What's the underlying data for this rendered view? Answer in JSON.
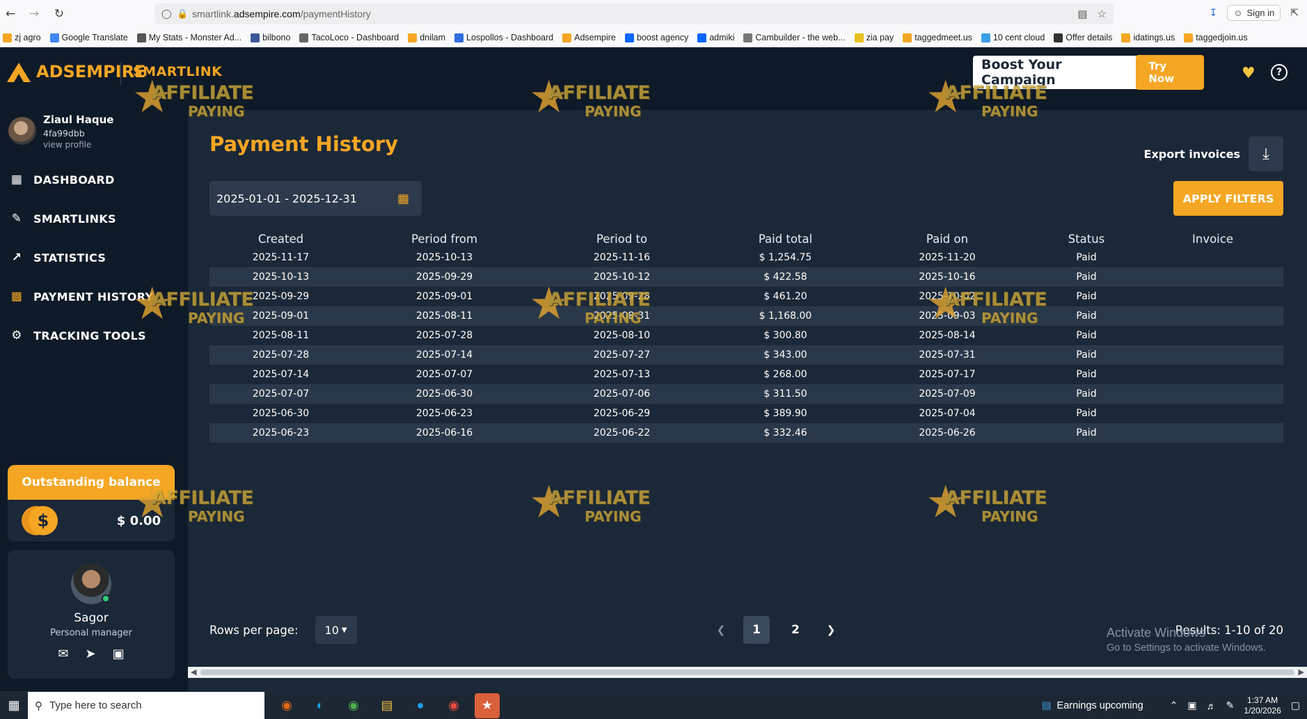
{
  "browser": {
    "url_host": "smartlink.adsempire.com",
    "url_path": "/paymentHistory",
    "url_prefix": "smartlink.",
    "url_domain": "adsempire.com",
    "sign_in": "Sign in",
    "bookmarks": [
      {
        "label": "zj agro",
        "color": "#f5a623"
      },
      {
        "label": "Google Translate",
        "color": "#4285f4"
      },
      {
        "label": "My Stats - Monster Ad...",
        "color": "#555555"
      },
      {
        "label": "bilbono",
        "color": "#3b5998"
      },
      {
        "label": "TacoLoco - Dashboard",
        "color": "#666666"
      },
      {
        "label": "dnilam",
        "color": "#f5a623"
      },
      {
        "label": "Lospollos - Dashboard",
        "color": "#2d6cdf"
      },
      {
        "label": "Adsempire",
        "color": "#f5a623"
      },
      {
        "label": "boost agency",
        "color": "#0866ff"
      },
      {
        "label": "admiki",
        "color": "#0866ff"
      },
      {
        "label": "Cambuilder - the web...",
        "color": "#777777"
      },
      {
        "label": "zia pay",
        "color": "#e8c020"
      },
      {
        "label": "taggedmeet.us",
        "color": "#f5a623"
      },
      {
        "label": "10 cent cloud",
        "color": "#3aa0e8"
      },
      {
        "label": "Offer details",
        "color": "#333333"
      },
      {
        "label": "idatings.us",
        "color": "#f5a623"
      },
      {
        "label": "taggedjoin.us",
        "color": "#f5a623"
      }
    ]
  },
  "header": {
    "logo_ads": "ADS",
    "logo_empire": "EMPIRE",
    "product": "SMARTLINK",
    "boost_text": "Boost Your Campaign",
    "try_now": "Try Now"
  },
  "profile": {
    "name": "Ziaul Haque",
    "id": "4fa99dbb",
    "view_profile": "view profile"
  },
  "sidebar": {
    "items": [
      {
        "label": "DASHBOARD",
        "icon": "dashboard-icon"
      },
      {
        "label": "SMARTLINKS",
        "icon": "smartlinks-icon"
      },
      {
        "label": "STATISTICS",
        "icon": "statistics-icon"
      },
      {
        "label": "PAYMENT HISTORY",
        "icon": "payment-history-icon"
      },
      {
        "label": "TRACKING TOOLS",
        "icon": "gear-icon"
      }
    ]
  },
  "balance": {
    "title": "Outstanding balance",
    "amount": "$ 0.00"
  },
  "manager": {
    "name": "Sagor",
    "role": "Personal manager"
  },
  "main": {
    "title": "Payment History",
    "export_label": "Export invoices",
    "date_range": "2025-01-01 - 2025-12-31",
    "apply_filters": "APPLY FILTERS",
    "columns": [
      "Created",
      "Period from",
      "Period to",
      "Paid total",
      "Paid on",
      "Status",
      "Invoice"
    ],
    "rows": [
      [
        "2025-11-17",
        "2025-10-13",
        "2025-11-16",
        "$ 1,254.75",
        "2025-11-20",
        "Paid",
        ""
      ],
      [
        "2025-10-13",
        "2025-09-29",
        "2025-10-12",
        "$ 422.58",
        "2025-10-16",
        "Paid",
        ""
      ],
      [
        "2025-09-29",
        "2025-09-01",
        "2025-09-28",
        "$ 461.20",
        "2025-10-02",
        "Paid",
        ""
      ],
      [
        "2025-09-01",
        "2025-08-11",
        "2025-08-31",
        "$ 1,168.00",
        "2025-09-03",
        "Paid",
        ""
      ],
      [
        "2025-08-11",
        "2025-07-28",
        "2025-08-10",
        "$ 300.80",
        "2025-08-14",
        "Paid",
        ""
      ],
      [
        "2025-07-28",
        "2025-07-14",
        "2025-07-27",
        "$ 343.00",
        "2025-07-31",
        "Paid",
        ""
      ],
      [
        "2025-07-14",
        "2025-07-07",
        "2025-07-13",
        "$ 268.00",
        "2025-07-17",
        "Paid",
        ""
      ],
      [
        "2025-07-07",
        "2025-06-30",
        "2025-07-06",
        "$ 311.50",
        "2025-07-09",
        "Paid",
        ""
      ],
      [
        "2025-06-30",
        "2025-06-23",
        "2025-06-29",
        "$ 389.90",
        "2025-07-04",
        "Paid",
        ""
      ],
      [
        "2025-06-23",
        "2025-06-16",
        "2025-06-22",
        "$ 332.46",
        "2025-06-26",
        "Paid",
        ""
      ]
    ],
    "rows_per_page_label": "Rows per page:",
    "rows_per_page": "10",
    "pages": [
      "1",
      "2"
    ],
    "current_page": "1",
    "results": "Results: 1-10 of 20"
  },
  "windows_notice": {
    "line1": "Activate Windows",
    "line2": "Go to Settings to activate Windows."
  },
  "watermark": {
    "line1": "AFFILIATE",
    "line2": "PAYING"
  },
  "taskbar": {
    "search_placeholder": "Type here to search",
    "news": "Earnings upcoming",
    "time": "1:37 AM",
    "date": "1/20/2026"
  }
}
